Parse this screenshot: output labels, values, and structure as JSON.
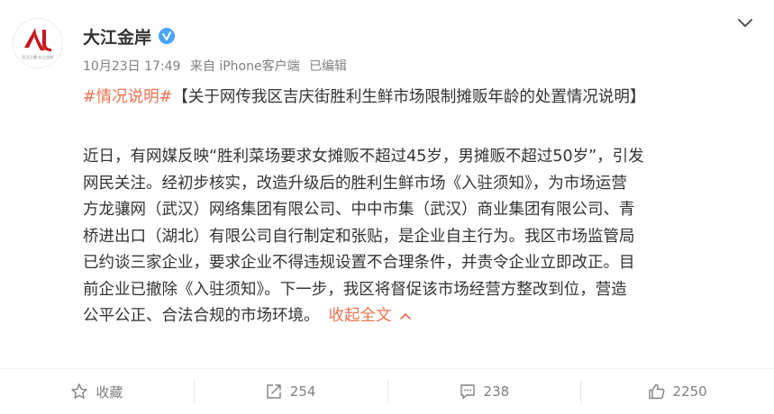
{
  "author": {
    "name": "大江金岸",
    "avatar_tagline": "武汉之春·长江金岸",
    "verified_icon": "verified-badge-icon",
    "brand_color": "#c8161d"
  },
  "meta": {
    "date": "10月23日 17:49",
    "source": "来自 iPhone客户端",
    "edited": "已编辑"
  },
  "post": {
    "hashtag": "#情况说明#",
    "title": "【关于网传我区吉庆街胜利生鲜市场限制摊贩年龄的处置情况说明】",
    "lines": [
      "近日，有网媒反映“胜利菜场要求女摊贩不超过45岁，男摊贩不超过50岁”，引发",
      "网民关注。经初步核实，改造升级后的胜利生鲜市场《入驻须知》，为市场运营",
      "方龙骧网（武汉）网络集团有限公司、中中市集（武汉）商业集团有限公司、青",
      "桥进出口（湖北）有限公司自行制定和张贴，是企业自主行为。我区市场监管局",
      "已约谈三家企业，要求企业不得违规设置不合理条件，并责令企业立即改正。目",
      "前企业已撤除《入驻须知》。下一步，我区将督促该市场经营方整改到位，营造",
      "公平公正、合法合规的市场环境。"
    ],
    "collapse_label": "收起全文",
    "accent_color": "#eb7350"
  },
  "actions": {
    "favorite": {
      "label": "收藏",
      "icon": "star-icon"
    },
    "repost": {
      "label": "254",
      "icon": "repost-icon"
    },
    "comment": {
      "label": "238",
      "icon": "comment-icon"
    },
    "like": {
      "label": "2250",
      "icon": "thumbs-up-icon"
    }
  }
}
